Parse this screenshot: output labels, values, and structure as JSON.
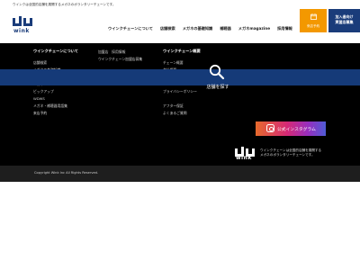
{
  "top_banner": {
    "tagline": "ウインクは全国的店舗を展開するメガネのボランタリーチェーンです。"
  },
  "header": {
    "logo_text": "wink",
    "nav": [
      "ウインクチェーンについて",
      "店舗検索",
      "メガネの基礎知識",
      "補聴器",
      "メガネmagazine",
      "採用情報"
    ],
    "reserve_label": "来店予約",
    "recruit_label_1": "加入者向け",
    "recruit_label_2": "実習店募集"
  },
  "footer": {
    "col1": {
      "title": "ウインクチェーンについて",
      "items": [
        "店舗検索",
        "メガネの基礎知識",
        "補聴器",
        "メガネ",
        "ピックアップ",
        "WDWS",
        "メガネ・補聴器用語集",
        "来店予約"
      ]
    },
    "col2": {
      "items": [
        "加盟店　採用情報",
        "ウインクチェーン加盟店募集"
      ]
    },
    "col3": {
      "title": "ウインクチェーン概要",
      "items": [
        "チェーン概要",
        "会社概要",
        "",
        "",
        "プライバシーポリシー",
        "",
        "アフター保証",
        "よくあるご質問"
      ]
    },
    "search_label": "店舗を探す",
    "instagram_label": "公式インスタグラム",
    "logo_text": "wink",
    "desc_line1": "ウインクチェーンは全国的店舗を展開する",
    "desc_line2": "メガネのボランタリーチェーンです。",
    "copyright": "Copyright Wink Inc All Rights Reserved."
  },
  "colors": {
    "brand_navy": "#1a3c7a",
    "reserve_orange": "#f39800",
    "footer_black": "#000000",
    "search_band": "#153a78"
  },
  "icons": {
    "reserve": "calendar-icon",
    "search": "magnifier-icon",
    "instagram": "instagram-icon"
  }
}
